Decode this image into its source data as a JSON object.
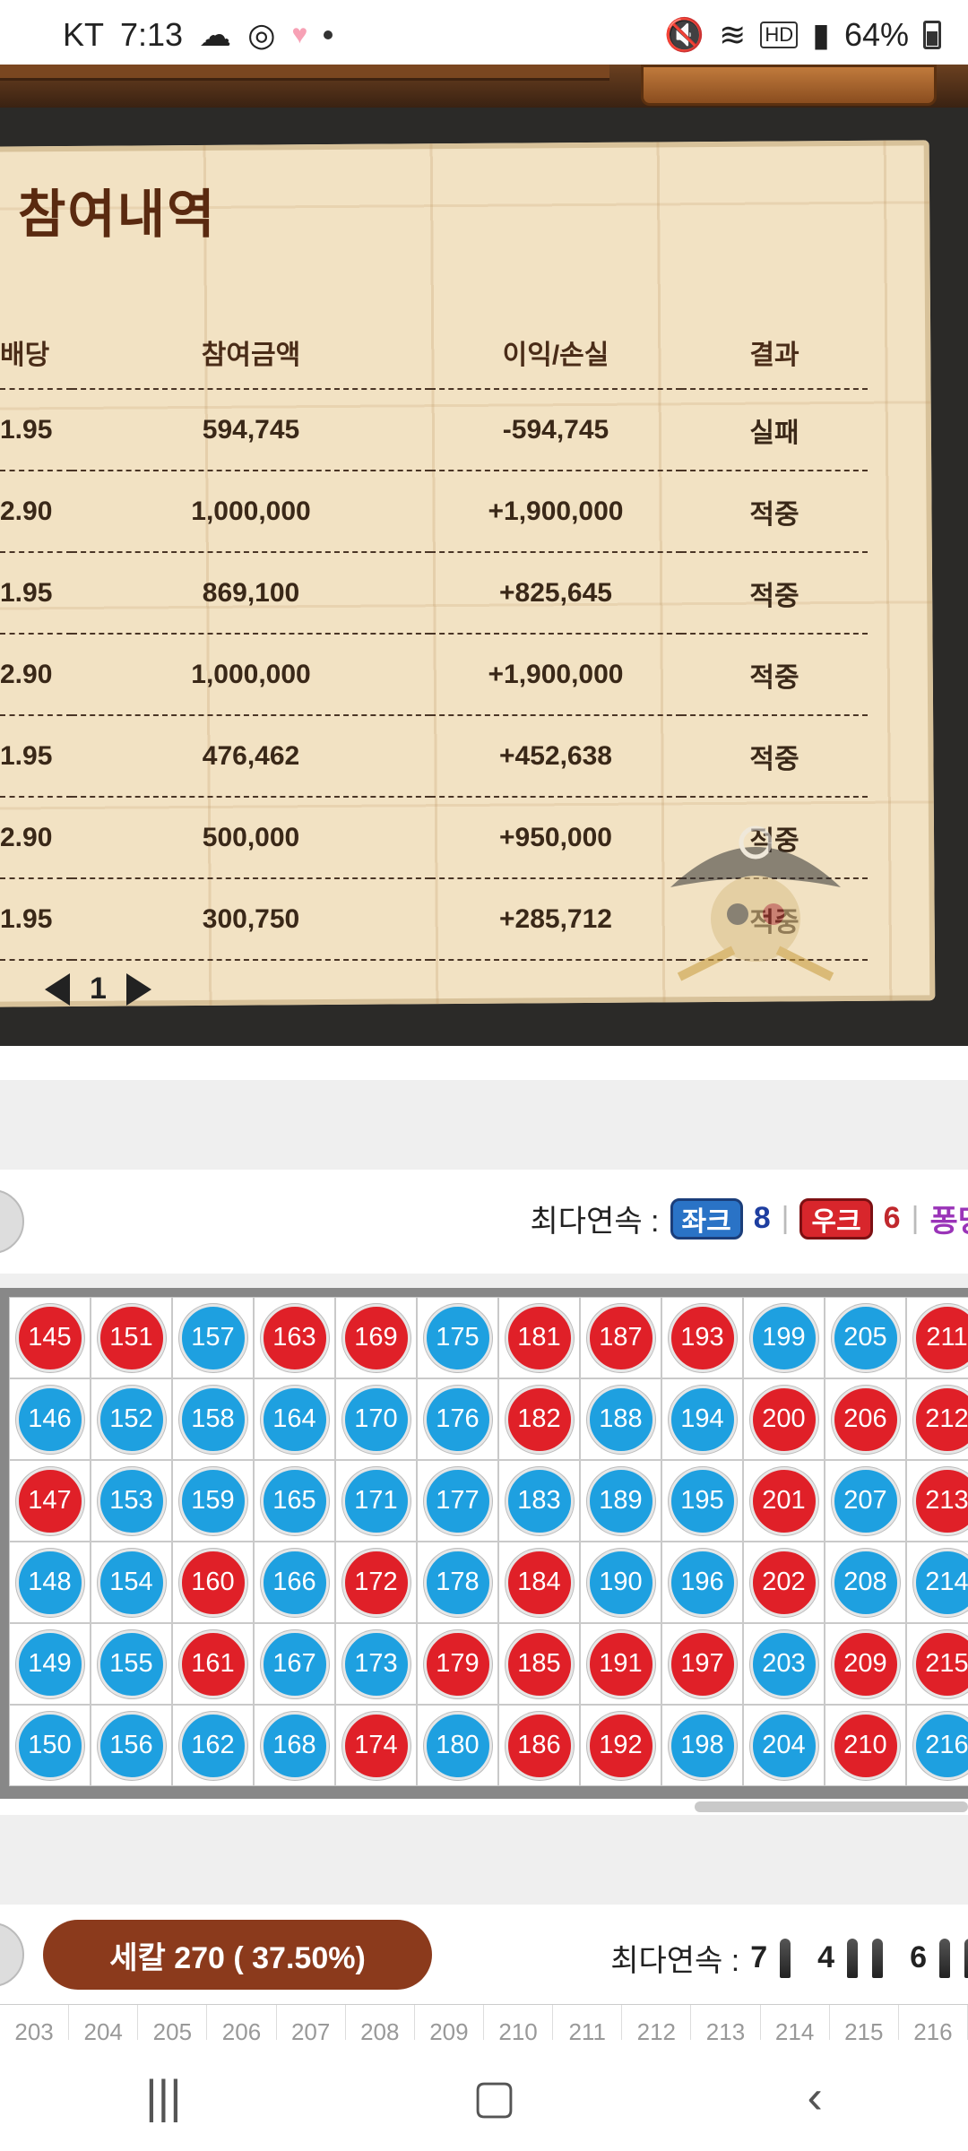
{
  "status": {
    "carrier": "KT",
    "time": "7:13",
    "battery": "64%"
  },
  "panel": {
    "title": "참여내역",
    "columns": [
      "배당",
      "참여금액",
      "이익/손실",
      "결과"
    ],
    "rows": [
      {
        "odds": "1.95",
        "amount": "594,745",
        "pl": "-594,745",
        "result": "실패"
      },
      {
        "odds": "2.90",
        "amount": "1,000,000",
        "pl": "+1,900,000",
        "result": "적중"
      },
      {
        "odds": "1.95",
        "amount": "869,100",
        "pl": "+825,645",
        "result": "적중"
      },
      {
        "odds": "2.90",
        "amount": "1,000,000",
        "pl": "+1,900,000",
        "result": "적중"
      },
      {
        "odds": "1.95",
        "amount": "476,462",
        "pl": "+452,638",
        "result": "적중"
      },
      {
        "odds": "2.90",
        "amount": "500,000",
        "pl": "+950,000",
        "result": "적중"
      },
      {
        "odds": "1.95",
        "amount": "300,750",
        "pl": "+285,712",
        "result": "적중"
      }
    ],
    "page": "1"
  },
  "streak1": {
    "label": "최다연속 :",
    "left_badge": "좌크",
    "left_count": "8",
    "right_badge": "우크",
    "right_count": "6",
    "extra": "퐁당"
  },
  "grid": {
    "columns": [
      {
        "numbers": [
          145,
          146,
          147,
          148,
          149,
          150
        ],
        "colors": [
          "red",
          "blue",
          "red",
          "blue",
          "blue",
          "blue"
        ]
      },
      {
        "numbers": [
          151,
          152,
          153,
          154,
          155,
          156
        ],
        "colors": [
          "red",
          "blue",
          "blue",
          "blue",
          "blue",
          "blue"
        ]
      },
      {
        "numbers": [
          157,
          158,
          159,
          160,
          161,
          162
        ],
        "colors": [
          "blue",
          "blue",
          "blue",
          "red",
          "red",
          "blue"
        ]
      },
      {
        "numbers": [
          163,
          164,
          165,
          166,
          167,
          168
        ],
        "colors": [
          "red",
          "blue",
          "blue",
          "blue",
          "blue",
          "blue"
        ]
      },
      {
        "numbers": [
          169,
          170,
          171,
          172,
          173,
          174
        ],
        "colors": [
          "red",
          "blue",
          "blue",
          "red",
          "blue",
          "red"
        ]
      },
      {
        "numbers": [
          175,
          176,
          177,
          178,
          179,
          180
        ],
        "colors": [
          "blue",
          "blue",
          "blue",
          "blue",
          "red",
          "blue"
        ]
      },
      {
        "numbers": [
          181,
          182,
          183,
          184,
          185,
          186
        ],
        "colors": [
          "red",
          "red",
          "blue",
          "red",
          "red",
          "red"
        ]
      },
      {
        "numbers": [
          187,
          188,
          189,
          190,
          191,
          192
        ],
        "colors": [
          "red",
          "blue",
          "blue",
          "blue",
          "red",
          "red"
        ]
      },
      {
        "numbers": [
          193,
          194,
          195,
          196,
          197,
          198
        ],
        "colors": [
          "red",
          "blue",
          "blue",
          "blue",
          "red",
          "blue"
        ]
      },
      {
        "numbers": [
          199,
          200,
          201,
          202,
          203,
          204
        ],
        "colors": [
          "blue",
          "red",
          "red",
          "red",
          "blue",
          "blue"
        ]
      },
      {
        "numbers": [
          205,
          206,
          207,
          208,
          209,
          210
        ],
        "colors": [
          "blue",
          "red",
          "blue",
          "blue",
          "red",
          "red"
        ]
      },
      {
        "numbers": [
          211,
          212,
          213,
          214,
          215,
          216
        ],
        "colors": [
          "red",
          "red",
          "red",
          "blue",
          "red",
          "blue"
        ]
      }
    ]
  },
  "knife": {
    "bar_label": "세칼 270 ( 37.50%)",
    "streak_label": "최다연속 :",
    "streak_a": "7",
    "streak_b": "4",
    "streak_c": "6"
  },
  "ticks": [
    "203",
    "204",
    "205",
    "206",
    "207",
    "208",
    "209",
    "210",
    "211",
    "212",
    "213",
    "214",
    "215",
    "216"
  ]
}
